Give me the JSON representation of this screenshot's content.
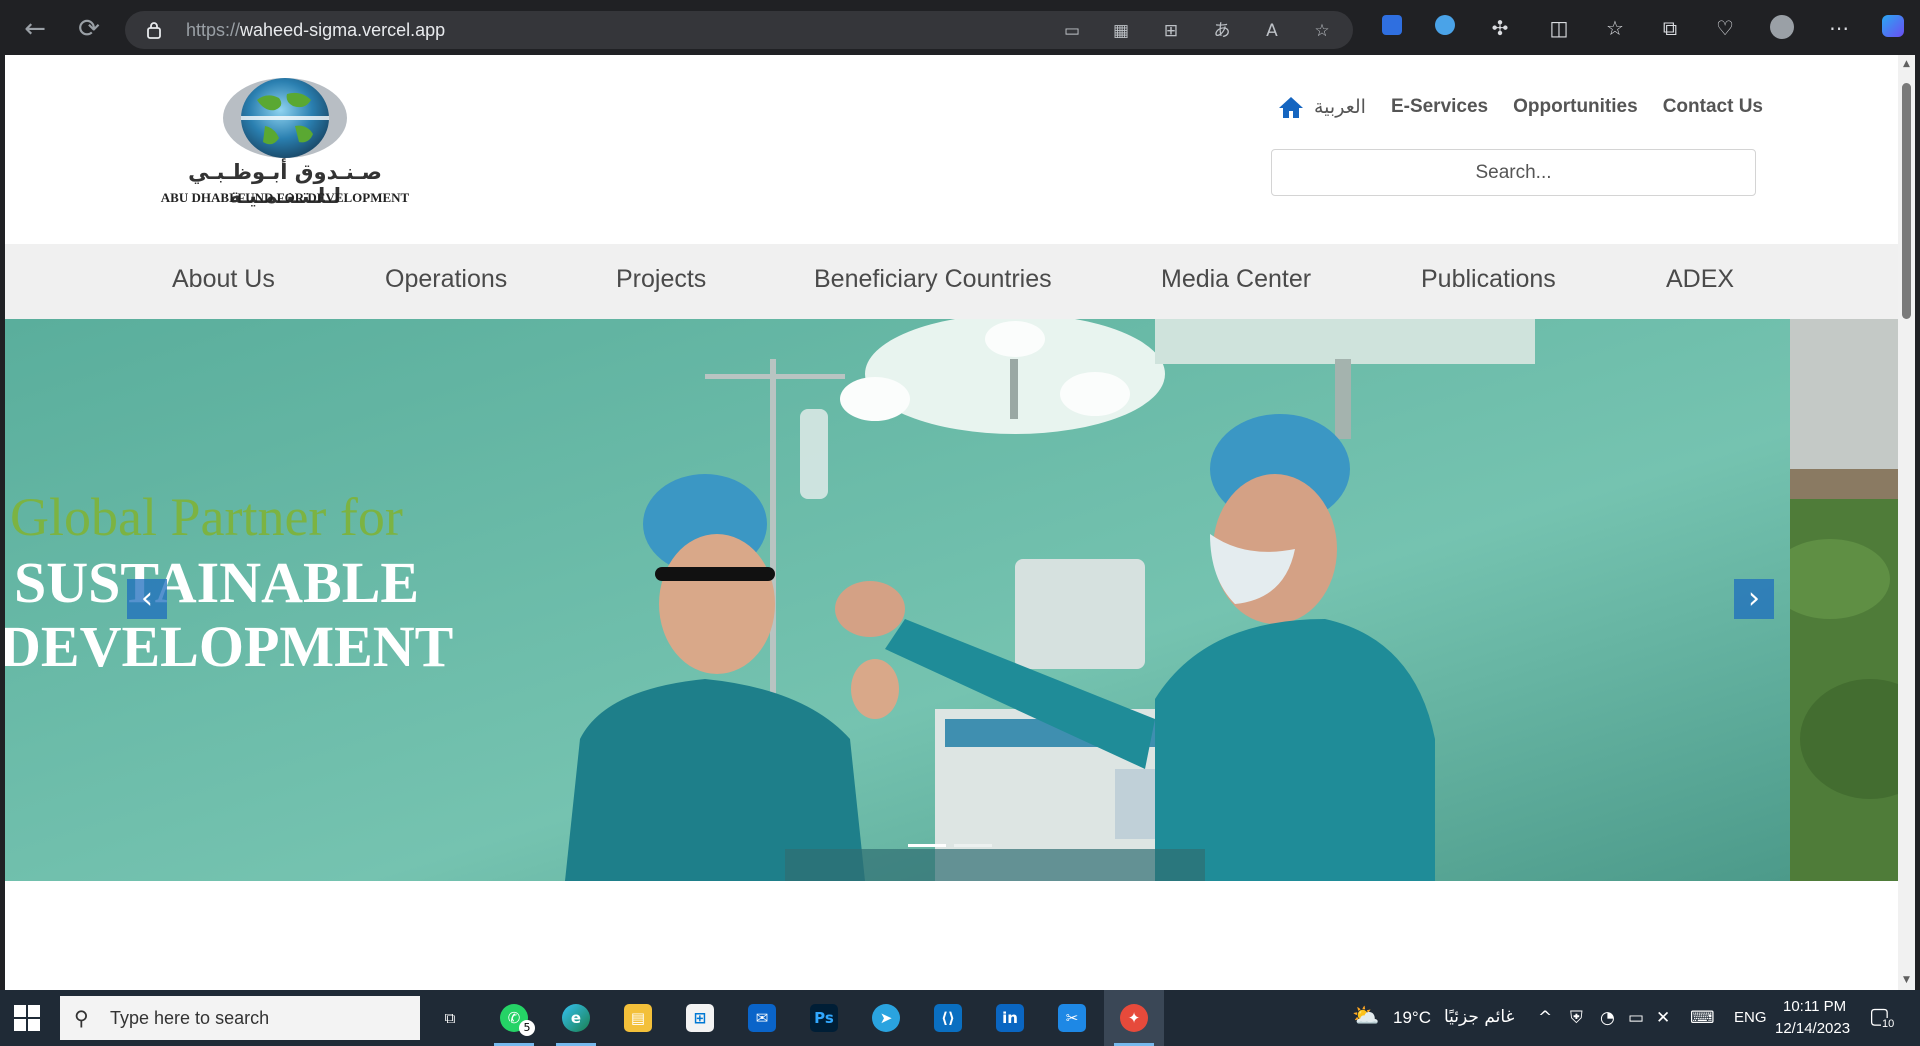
{
  "browser": {
    "url_protocol": "https://",
    "url_host": "waheed-sigma.vercel.app"
  },
  "header": {
    "logo_arabic": "صـنـدوق أبـوظـبـي لـلـتـنـمـيـة",
    "logo_english": "ABU DHABI FUND FOR DEVELOPMENT",
    "links": {
      "arabic": "العربية",
      "eservices": "E-Services",
      "opportunities": "Opportunities",
      "contact": "Contact Us"
    },
    "search_placeholder": "Search..."
  },
  "main_nav": {
    "items": [
      "About Us",
      "Operations",
      "Projects",
      "Beneficiary Countries",
      "Media Center",
      "Publications",
      "ADEX"
    ]
  },
  "hero": {
    "line1": "Global Partner for",
    "line2": "SUSTAINABLE",
    "line3": "DEVELOPMENT",
    "slide_count": 2,
    "active_slide": 1
  },
  "taskbar": {
    "search_placeholder": "Type here to search",
    "whatsapp_badge": "5",
    "weather_temp": "19°C",
    "weather_desc": "غائم جزئيًا",
    "language": "ENG",
    "time": "10:11 PM",
    "date": "12/14/2023",
    "notifications": "10"
  },
  "colors": {
    "accent_green": "#7cb342",
    "nav_bg": "#f0f0f0",
    "home_icon": "#1565c0"
  }
}
